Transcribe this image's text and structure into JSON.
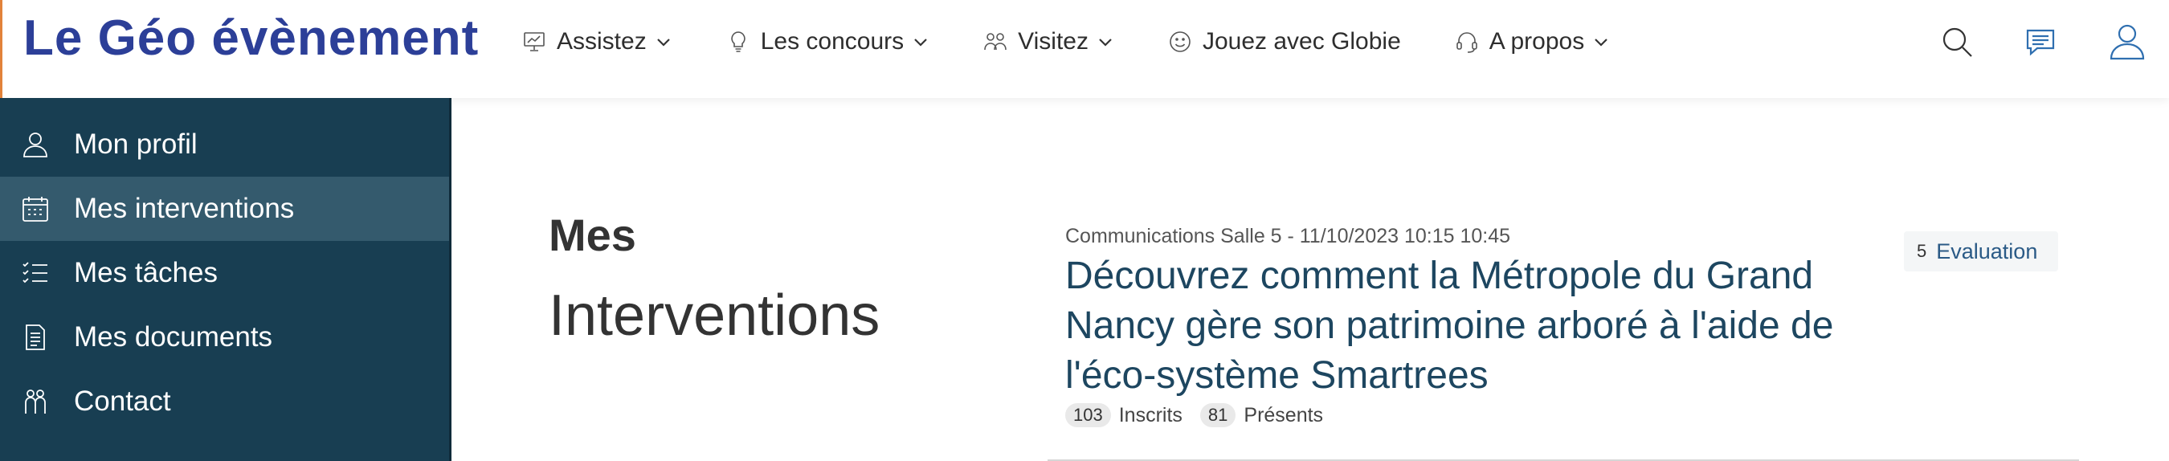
{
  "header": {
    "logo": "Le Géo évènement",
    "nav": [
      {
        "label": "Assistez",
        "icon": "presentation-icon",
        "has_dropdown": true
      },
      {
        "label": "Les concours",
        "icon": "lightbulb-icon",
        "has_dropdown": true
      },
      {
        "label": "Visitez",
        "icon": "people-icon",
        "has_dropdown": true
      },
      {
        "label": "Jouez avec Globie",
        "icon": "smiley-icon",
        "has_dropdown": false
      },
      {
        "label": "A propos",
        "icon": "headset-icon",
        "has_dropdown": true
      }
    ],
    "actions": [
      "search-icon",
      "messages-icon",
      "user-icon"
    ]
  },
  "sidebar": {
    "items": [
      {
        "label": "Mon profil",
        "icon": "user-icon",
        "active": false
      },
      {
        "label": "Mes interventions",
        "icon": "calendar-icon",
        "active": true
      },
      {
        "label": "Mes tâches",
        "icon": "checklist-icon",
        "active": false
      },
      {
        "label": "Mes documents",
        "icon": "document-icon",
        "active": false
      },
      {
        "label": "Contact",
        "icon": "contact-icon",
        "active": false
      }
    ]
  },
  "main": {
    "title_line1": "Mes",
    "title_line2": "Interventions",
    "intervention": {
      "meta": "Communications Salle 5 - 11/10/2023 10:15 10:45",
      "title": "Découvrez comment la Métropole du Grand Nancy gère son patrimoine arboré à l'aide de l'éco-système Smartrees",
      "registered_count": "103",
      "registered_label": "Inscrits",
      "present_count": "81",
      "present_label": "Présents",
      "evaluation_count": "5",
      "evaluation_label": "Evaluation"
    }
  },
  "colors": {
    "logo": "#2c3f98",
    "sidebar_bg": "#183e52",
    "sidebar_active": "#345a6d",
    "title_link": "#1d4660",
    "accent_blue": "#2a5a86",
    "header_edge": "#e2823a"
  }
}
